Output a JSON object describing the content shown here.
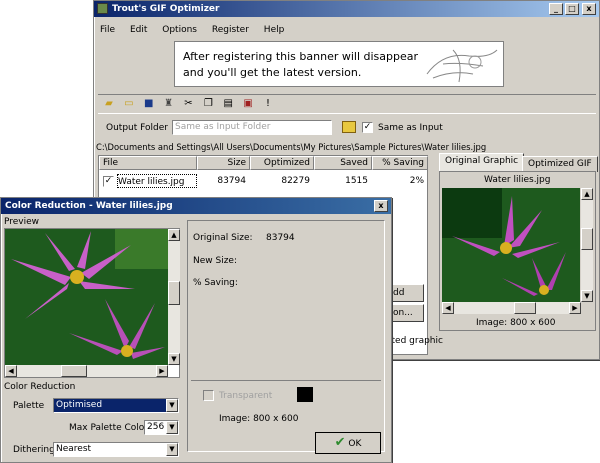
{
  "main_window": {
    "title": "Trout's GIF Optimizer",
    "menu": [
      "File",
      "Edit",
      "Options",
      "Register",
      "Help"
    ],
    "banner_text_line1": "After registering this banner will disappear",
    "banner_text_line2": "and you'll get the latest version.",
    "output_folder_label": "Output Folder",
    "output_folder_placeholder": "Same as Input Folder",
    "same_as_input_label": "Same as Input",
    "path": "C:\\Documents and Settings\\All Users\\Documents\\My Pictures\\Sample Pictures\\Water lilies.jpg",
    "table": {
      "columns": [
        "File",
        "Size",
        "Optimized",
        "Saved",
        "% Saving"
      ],
      "rows": [
        {
          "file": "Water lilies.jpg",
          "size": "83794",
          "optimized": "82279",
          "saved": "1515",
          "saving": "2%"
        }
      ]
    },
    "tabs": [
      "Original Graphic",
      "Optimized GIF"
    ],
    "preview_caption": "Water lilies.jpg",
    "image_info": "Image: 800 x 600",
    "partial_button_1": "dd",
    "partial_button_2": "on...",
    "partial_status": "tted graphic"
  },
  "dialog": {
    "title": "Color Reduction - Water lilies.jpg",
    "preview_label": "Preview",
    "original_size_label": "Original Size:",
    "original_size_value": "83794",
    "new_size_label": "New Size:",
    "saving_label": "% Saving:",
    "color_reduction_label": "Color Reduction",
    "palette_label": "Palette",
    "palette_value": "Optimised",
    "max_colors_label": "Max Palette Colors",
    "max_colors_value": "256",
    "dithering_label": "Dithering",
    "dithering_value": "Nearest",
    "transparent_label": "Transparent",
    "image_info": "Image: 800 x 600",
    "ok_label": "OK"
  },
  "colors": {
    "title_active": "#0a246a",
    "face": "#d4d0c8",
    "selection": "#0a246a",
    "ok_check": "#2e8b2e"
  }
}
